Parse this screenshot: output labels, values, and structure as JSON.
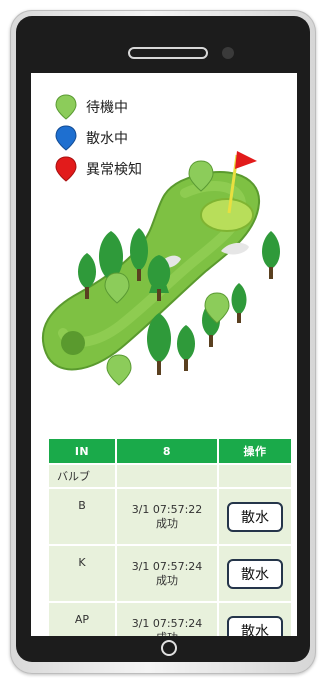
{
  "legend": {
    "waiting": {
      "label": "待機中",
      "color": "#8ccc5a"
    },
    "spraying": {
      "label": "散水中",
      "color": "#1e6fd0"
    },
    "error": {
      "label": "異常検知",
      "color": "#e21b1b"
    }
  },
  "table": {
    "headers": {
      "col1": "IN",
      "col2": "8",
      "col3": "操作"
    },
    "section_label": "バルブ",
    "rows": [
      {
        "name": "B",
        "time": "3/1 07:57:22",
        "result": "成功",
        "button": "散水"
      },
      {
        "name": "K",
        "time": "3/1 07:57:24",
        "result": "成功",
        "button": "散水"
      },
      {
        "name": "AP",
        "time": "3/1 07:57:24",
        "result": "成功",
        "button": "散水"
      }
    ]
  },
  "colors": {
    "header_green": "#1aaa4a",
    "cell_bg": "#e8f1dc",
    "fairway": "#7ec143",
    "flag": "#e21b1b"
  }
}
